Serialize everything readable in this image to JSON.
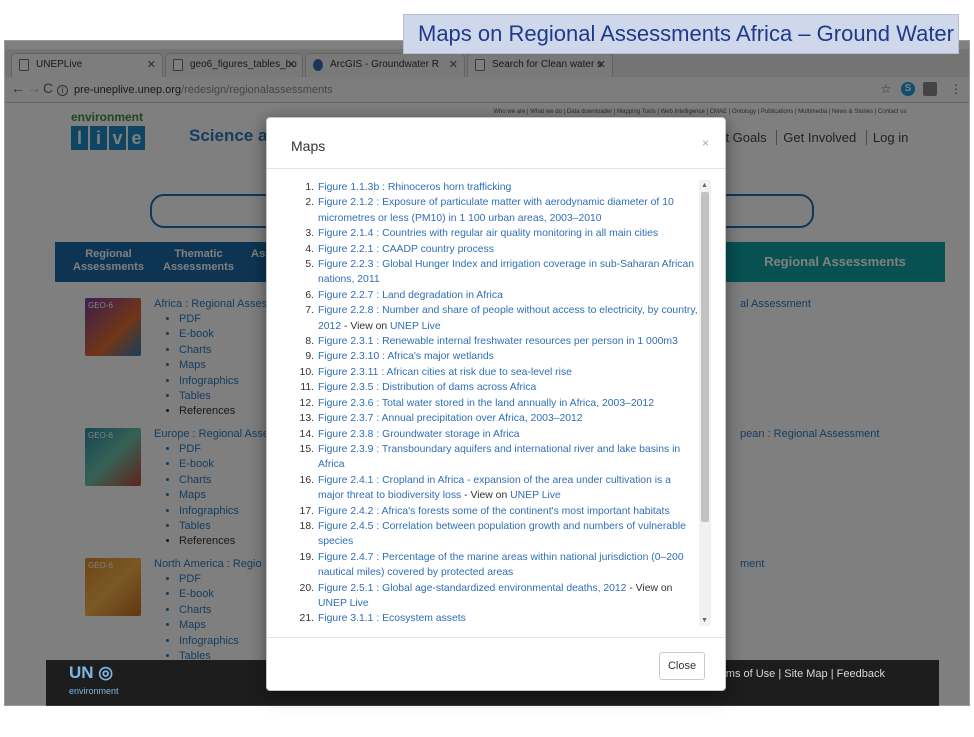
{
  "slide": {
    "title": "Maps on Regional Assessments Africa – Ground Water"
  },
  "browser": {
    "tabs": [
      {
        "label": "UNEPLive"
      },
      {
        "label": "geo6_figures_tables_bo"
      },
      {
        "label": "ArcGIS - Groundwater R"
      },
      {
        "label": "Search for Clean water s"
      }
    ],
    "url": {
      "host": "pre-uneplive.unep.org",
      "path": "/redesign/regionalassessments"
    }
  },
  "site": {
    "logo_top": "environment",
    "logo_letters": [
      "l",
      "i",
      "v",
      "e"
    ],
    "tagline": "Science and data for people",
    "toplinks": "Who we are | What we do | Data downloader | Mapping Tools | Web Intelligence | CMAE | Ontology | Publications | Multimedia | News & Stories | Contact us",
    "user_nav": [
      "ent Goals",
      "Get Involved",
      "Log in"
    ],
    "nav": [
      {
        "line1": "Regional",
        "line2": "Assessments"
      },
      {
        "line1": "Thematic",
        "line2": "Assessments"
      },
      {
        "line1": "",
        "line2": "Ass"
      }
    ],
    "nav_active": "Regional Assessments",
    "regions": [
      {
        "title": "Africa : Regional Assess",
        "right": "al Assessment",
        "cover": "GEO-6"
      },
      {
        "title": "Europe : Regional Asse",
        "right": "pean : Regional Assessment",
        "cover": "GEO-6"
      },
      {
        "title": "North America : Regio",
        "right": "ment",
        "cover": "GEO-6"
      }
    ],
    "region_links": [
      "PDF",
      "E-book",
      "Charts",
      "Maps",
      "Infographics",
      "Tables",
      "References"
    ],
    "footer_logo": "UN",
    "footer_logo_sub": "environment",
    "footer_links": "erms of Use | Site Map | Feedback"
  },
  "modal": {
    "title": "Maps",
    "close_x": "×",
    "close_button": "Close",
    "view_on": " - View on ",
    "view_link": "UNEP Live",
    "items": [
      {
        "n": "1.",
        "text": "Figure 1.1.3b : Rhinoceros horn trafficking"
      },
      {
        "n": "2.",
        "text": "Figure 2.1.2 : Exposure of particulate matter with aerodynamic diameter of 10 micrometres or less (PM10) in 1 100 urban areas, 2003–2010"
      },
      {
        "n": "3.",
        "text": "Figure 2.1.4 : Countries with regular air quality monitoring in all main cities"
      },
      {
        "n": "4.",
        "text": "Figure 2.2.1 : CAADP country process"
      },
      {
        "n": "5.",
        "text": "Figure 2.2.3 : Global Hunger Index and irrigation coverage in sub-Saharan African nations, 2011"
      },
      {
        "n": "6.",
        "text": "Figure 2.2.7 : Land degradation in Africa"
      },
      {
        "n": "7.",
        "text": "Figure 2.2.8 : Number and share of people without access to electricity, by country, 2012",
        "view": true
      },
      {
        "n": "8.",
        "text": "Figure 2.3.1 : Renewable internal freshwater resources per person in 1 000m3"
      },
      {
        "n": "9.",
        "text": "Figure 2.3.10 : Africa's major wetlands"
      },
      {
        "n": "10.",
        "text": "Figure 2.3.11 : African cities at risk due to sea-level rise"
      },
      {
        "n": "11.",
        "text": "Figure 2.3.5 : Distribution of dams across Africa"
      },
      {
        "n": "12.",
        "text": "Figure 2.3.6 : Total water stored in the land annually in Africa, 2003–2012"
      },
      {
        "n": "13.",
        "text": "Figure 2.3.7 : Annual precipitation over Africa, 2003–2012"
      },
      {
        "n": "14.",
        "text": "Figure 2.3.8 : Groundwater storage in Africa"
      },
      {
        "n": "15.",
        "text": "Figure 2.3.9 : Transboundary aquifers and international river and lake basins in Africa"
      },
      {
        "n": "16.",
        "text": "Figure 2.4.1 : Cropland in Africa - expansion of the area under cultivation is a major threat to biodiversity loss",
        "view": true
      },
      {
        "n": "17.",
        "text": "Figure 2.4.2 : Africa's forests some of the continent's most important habitats"
      },
      {
        "n": "18.",
        "text": "Figure 2.4.5 : Correlation between population growth and numbers of vulnerable species"
      },
      {
        "n": "19.",
        "text": "Figure 2.4.7 : Percentage of the marine areas within national jurisdiction (0–200 nautical miles) covered by protected areas"
      },
      {
        "n": "20.",
        "text": "Figure 2.5.1 : Global age-standardized environmental deaths, 2012",
        "view": true
      },
      {
        "n": "21.",
        "text": "Figure 3.1.1 : Ecosystem assets"
      }
    ]
  },
  "colors": {
    "link": "#2f6fb5",
    "nav_blue": "#1b6aa6",
    "nav_teal": "#11a3a7",
    "title_box": "#cfd8ea"
  }
}
